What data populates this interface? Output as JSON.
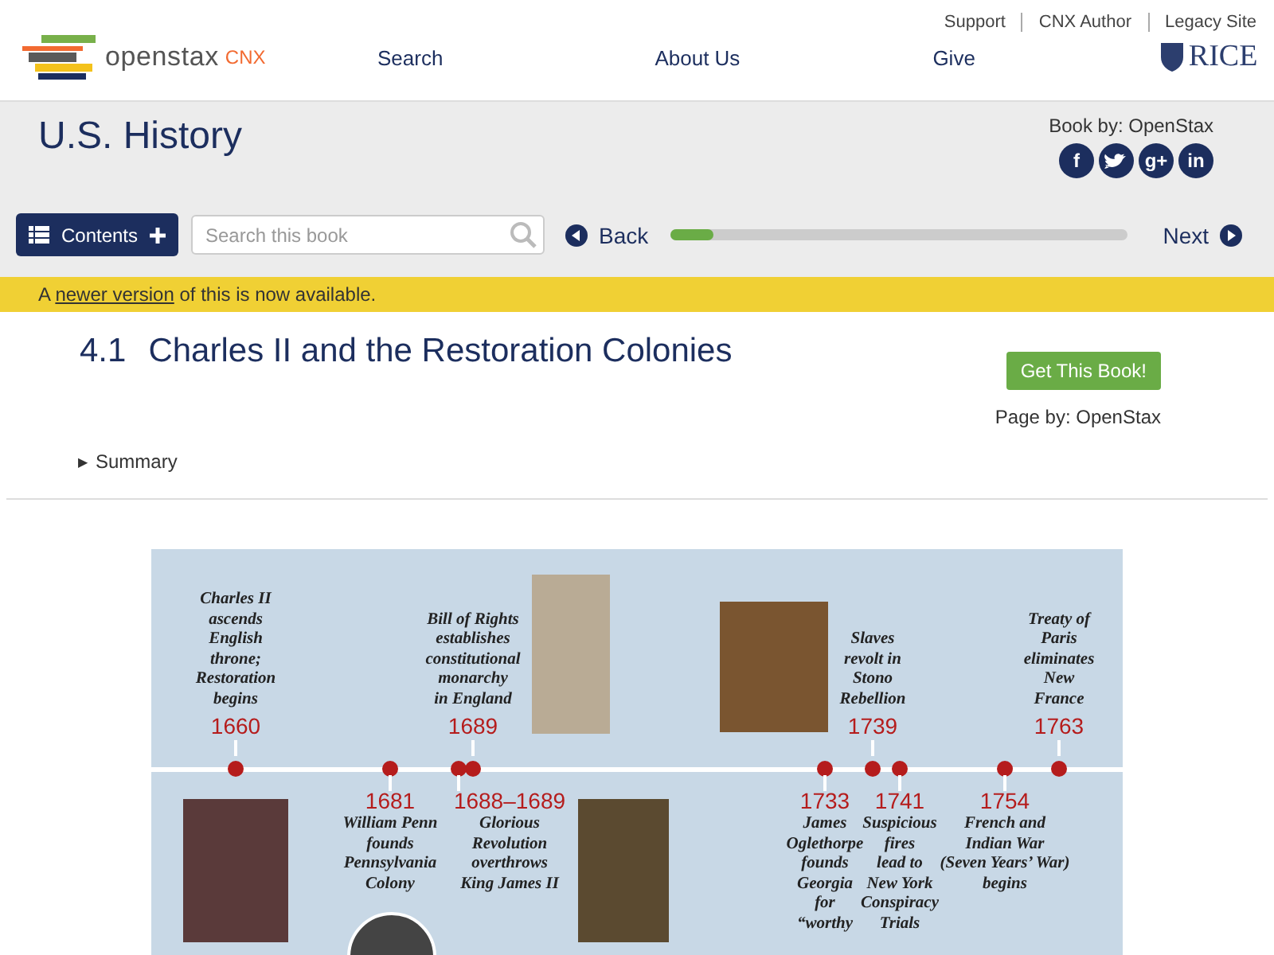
{
  "top_links": [
    "Support",
    "CNX Author",
    "Legacy Site"
  ],
  "logo": {
    "name": "openstax",
    "suffix": "CNX"
  },
  "nav": [
    "Search",
    "About Us",
    "Give"
  ],
  "partner": "RICE",
  "book": {
    "title": "U.S. History",
    "byline": "Book by: OpenStax",
    "social": [
      "f",
      "g+",
      "in"
    ]
  },
  "toolbar": {
    "contents": "Contents",
    "search_placeholder": "Search this book",
    "back": "Back",
    "next": "Next",
    "progress": {
      "level": 0.095
    }
  },
  "banner": {
    "before": "A ",
    "link": "newer version",
    "after": " of this is now available."
  },
  "page": {
    "number": "4.1",
    "title": "Charles II and the Restoration Colonies",
    "button": "Get This Book!",
    "byline": "Page by: OpenStax",
    "summary": {
      "toggle": "▶",
      "label": "Summary",
      "expanded": false
    }
  },
  "timeline_upper": [
    {
      "year": "1660",
      "text": "Charles II\nascends\nEnglish\nthrone;\nRestoration\nbegins"
    },
    {
      "year": "1689",
      "text": "Bill of Rights\nestablishes\nconstitutional\nmonarchy\nin England"
    },
    {
      "year": "1739",
      "text": "Slaves\nrevolt in\nStono\nRebellion"
    },
    {
      "year": "1763",
      "text": "Treaty of\nParis\neliminates\nNew\nFrance"
    }
  ],
  "timeline_lower": [
    {
      "year": "1681",
      "text": "William Penn\nfounds\nPennsylvania\nColony"
    },
    {
      "year": "1688–1689",
      "text": "Glorious\nRevolution\noverthrows\nKing James II"
    },
    {
      "year": "1733",
      "text": "James\nOglethorpe\nfounds\nGeorgia\nfor\n“worthy"
    },
    {
      "year": "1741",
      "text": "Suspicious\nfires\nlead to\nNew York\nConspiracy\nTrials"
    },
    {
      "year": "1754",
      "text": "French and\nIndian War\n(Seven Years’ War)\nbegins"
    }
  ]
}
